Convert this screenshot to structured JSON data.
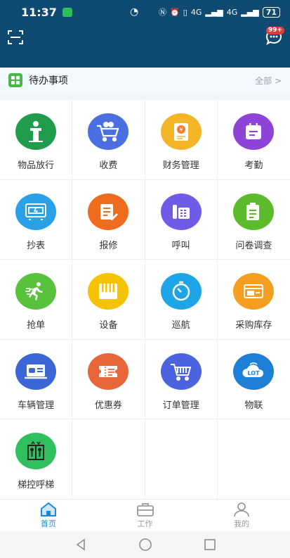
{
  "status_bar": {
    "time": "11:37",
    "network": "4G",
    "network2": "4G",
    "battery": "71"
  },
  "header": {
    "scan_icon": "scan-icon",
    "message_icon": "message-icon",
    "message_badge": "99+"
  },
  "todo": {
    "title": "待办事项",
    "all_label": "全部 >"
  },
  "apps": [
    {
      "label": "物品放行",
      "icon": "goods-release-icon",
      "color": "#1f9d4d"
    },
    {
      "label": "收费",
      "icon": "cart-icon",
      "color": "#4b6fe0"
    },
    {
      "label": "财务管理",
      "icon": "finance-icon",
      "color": "#f5b528"
    },
    {
      "label": "考勤",
      "icon": "calendar-icon",
      "color": "#8e44d6"
    },
    {
      "label": "抄表",
      "icon": "meter-icon",
      "color": "#2aa0e6"
    },
    {
      "label": "报修",
      "icon": "repair-icon",
      "color": "#ef6c1e"
    },
    {
      "label": "呼叫",
      "icon": "phone-icon",
      "color": "#6f5ce6"
    },
    {
      "label": "问卷调查",
      "icon": "survey-icon",
      "color": "#5cbb2a"
    },
    {
      "label": "抢单",
      "icon": "runner-icon",
      "color": "#58c23c"
    },
    {
      "label": "设备",
      "icon": "equipment-icon",
      "color": "#f5c200"
    },
    {
      "label": "巡航",
      "icon": "timer-icon",
      "color": "#1ea5e8"
    },
    {
      "label": "采购库存",
      "icon": "purchase-icon",
      "color": "#f59e1f"
    },
    {
      "label": "车辆管理",
      "icon": "vehicle-icon",
      "color": "#3b67d6"
    },
    {
      "label": "优惠券",
      "icon": "coupon-icon",
      "color": "#e8653a"
    },
    {
      "label": "订单管理",
      "icon": "order-cart-icon",
      "color": "#4c63e0"
    },
    {
      "label": "物联",
      "icon": "iot-cloud-icon",
      "color": "#1e7fd6"
    },
    {
      "label": "梯控呼梯",
      "icon": "elevator-icon",
      "color": "#2fc05d"
    }
  ],
  "tabs": [
    {
      "label": "首页",
      "icon": "home-icon",
      "active": true
    },
    {
      "label": "工作",
      "icon": "briefcase-icon",
      "active": false
    },
    {
      "label": "我的",
      "icon": "user-icon",
      "active": false
    }
  ],
  "nav": {
    "back_icon": "back-icon",
    "home_icon": "home-circle-icon",
    "recents_icon": "recents-icon"
  }
}
